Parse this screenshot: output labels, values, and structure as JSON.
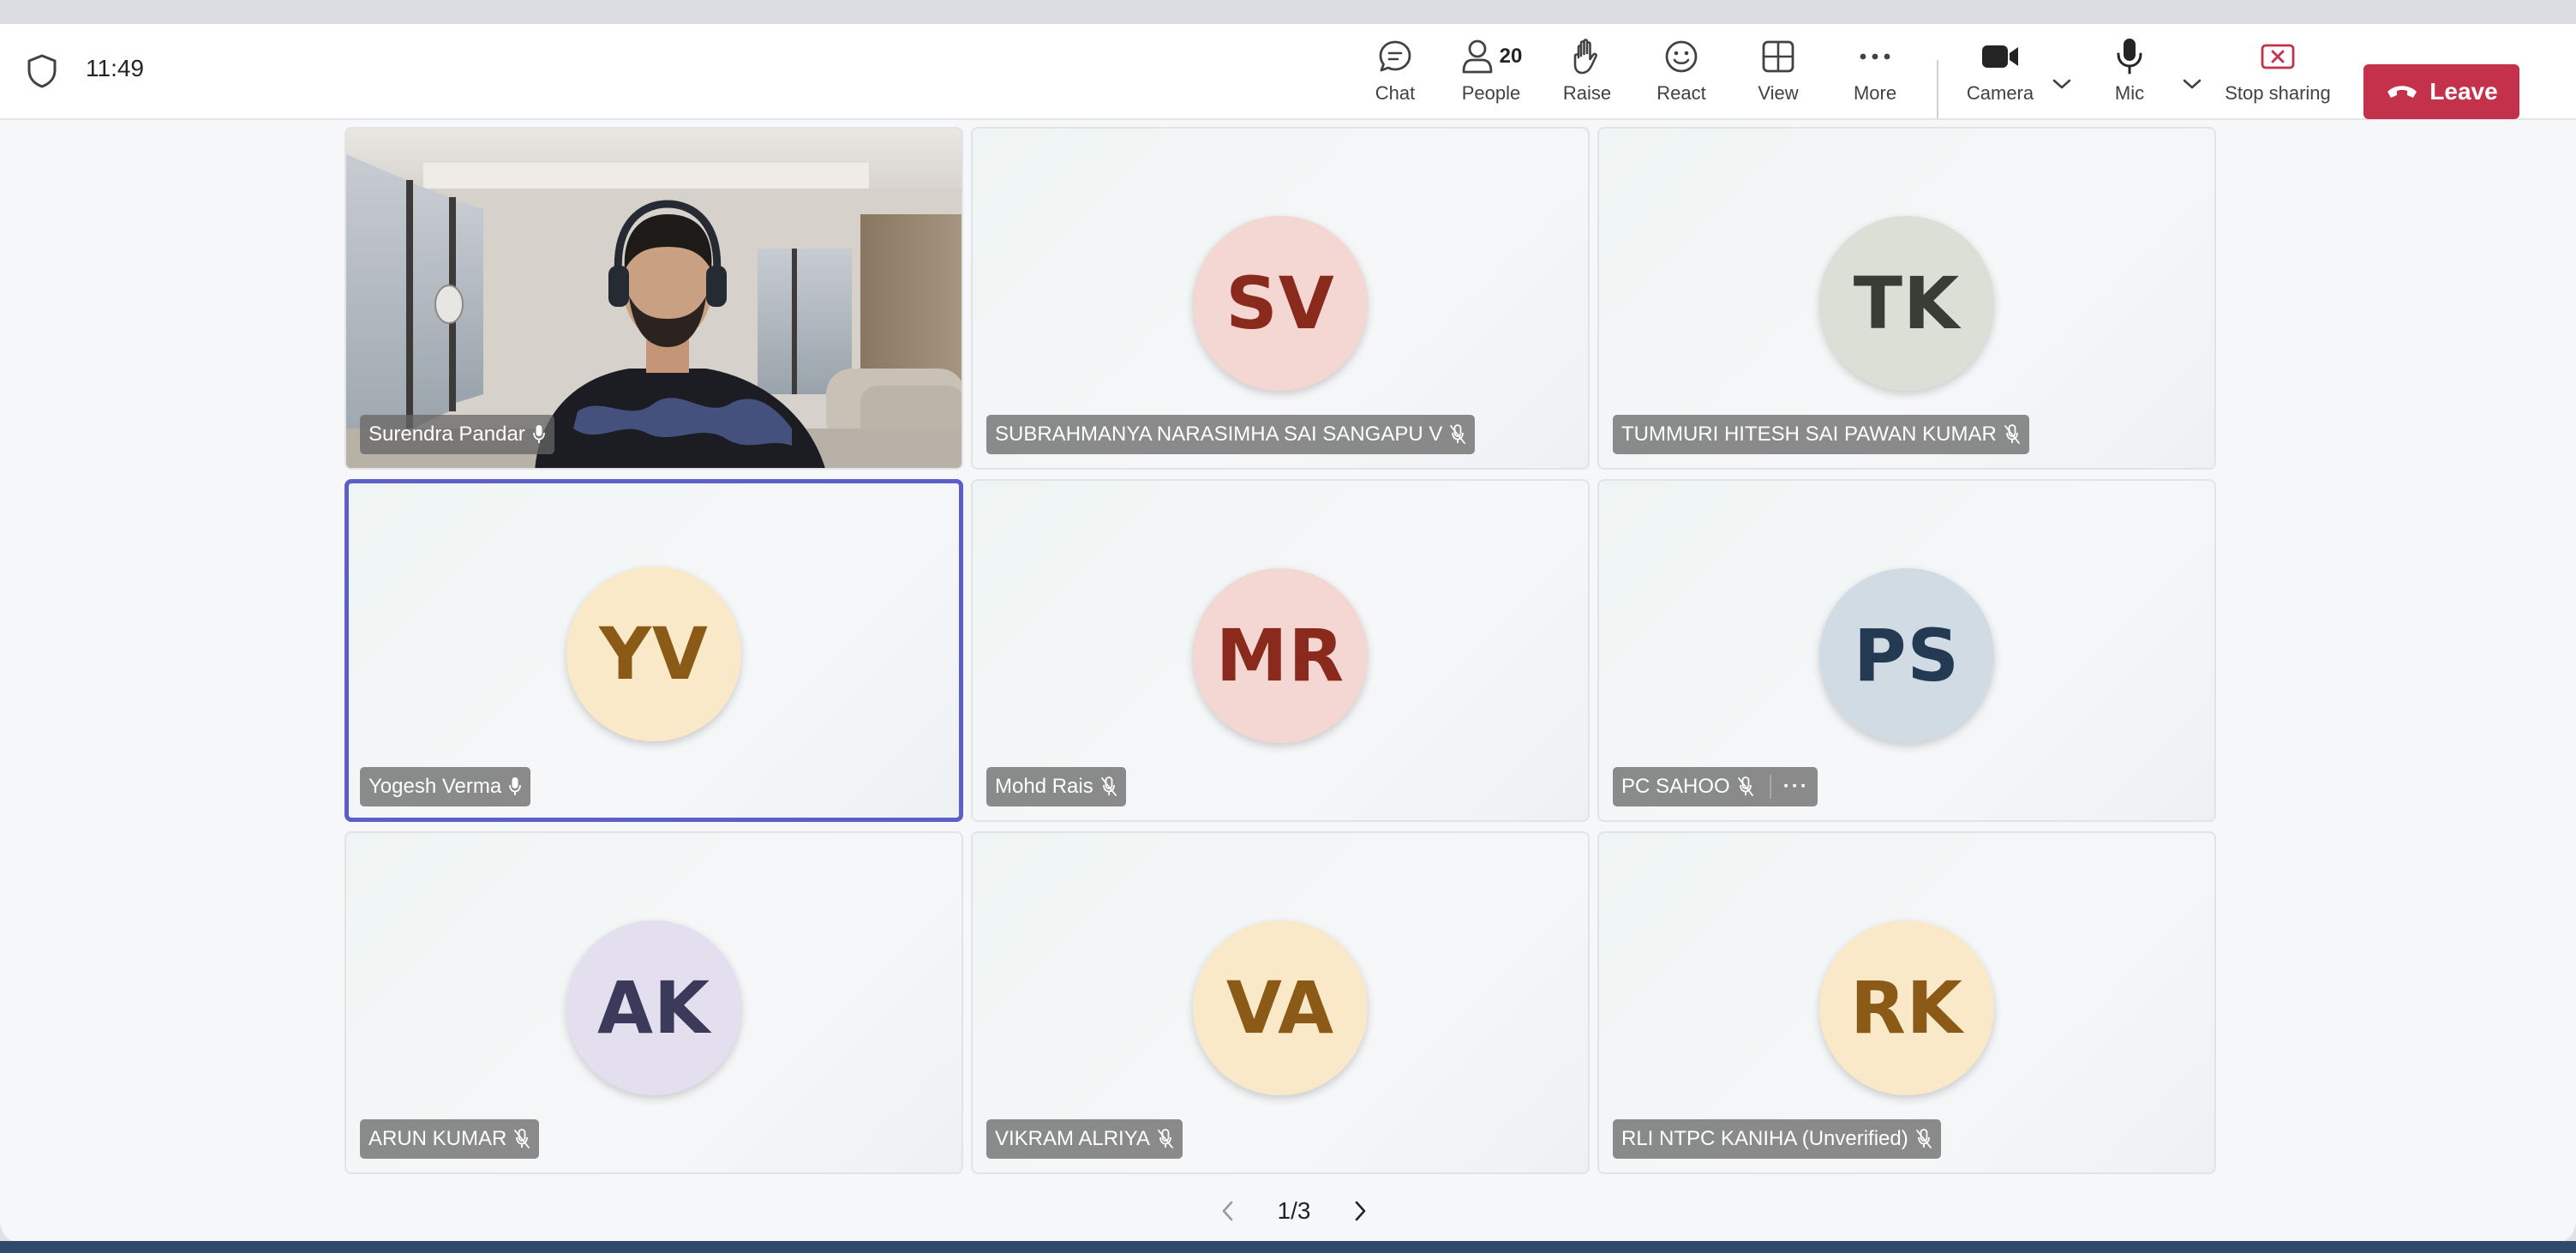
{
  "header": {
    "time": "11:49",
    "toolbar": {
      "chat": "Chat",
      "people": "People",
      "people_count": "20",
      "raise": "Raise",
      "react": "React",
      "view": "View",
      "more": "More",
      "camera": "Camera",
      "mic": "Mic",
      "stop_sharing": "Stop sharing",
      "leave": "Leave"
    }
  },
  "participants": [
    {
      "name": "Surendra Pandar",
      "initials": "",
      "video": true,
      "mic": "on"
    },
    {
      "name": "SUBRAHMANYA NARASIMHA SAI SANGAPU V",
      "initials": "SV",
      "mic": "muted",
      "avatar_bg": "#f4d6d2",
      "avatar_fg": "#8a2a1c"
    },
    {
      "name": "TUMMURI HITESH SAI PAWAN KUMAR",
      "initials": "TK",
      "mic": "muted",
      "avatar_bg": "#dcdfd6",
      "avatar_fg": "#3a3d36"
    },
    {
      "name": "Yogesh Verma",
      "initials": "YV",
      "mic": "on",
      "active": true,
      "avatar_bg": "#f9e9c9",
      "avatar_fg": "#8a5a16"
    },
    {
      "name": "Mohd Rais",
      "initials": "MR",
      "mic": "muted",
      "avatar_bg": "#f4d6d2",
      "avatar_fg": "#8a2a1c"
    },
    {
      "name": "PC SAHOO",
      "initials": "PS",
      "mic": "muted",
      "has_more": true,
      "more_label": "···",
      "avatar_bg": "#d1dbe4",
      "avatar_fg": "#243a52"
    },
    {
      "name": "ARUN KUMAR",
      "initials": "AK",
      "mic": "muted",
      "avatar_bg": "#e3dfee",
      "avatar_fg": "#3c3a5a"
    },
    {
      "name": "VIKRAM ALRIYA",
      "initials": "VA",
      "mic": "muted",
      "avatar_bg": "#f9e9c9",
      "avatar_fg": "#8a5a16"
    },
    {
      "name": "RLI NTPC KANIHA (Unverified)",
      "initials": "RK",
      "mic": "muted",
      "avatar_bg": "#f9e9c9",
      "avatar_fg": "#8a5a16"
    }
  ],
  "pager": {
    "label": "1/3"
  },
  "colors": {
    "leave_red": "#c4314b",
    "active_border": "#5b5fc7"
  }
}
